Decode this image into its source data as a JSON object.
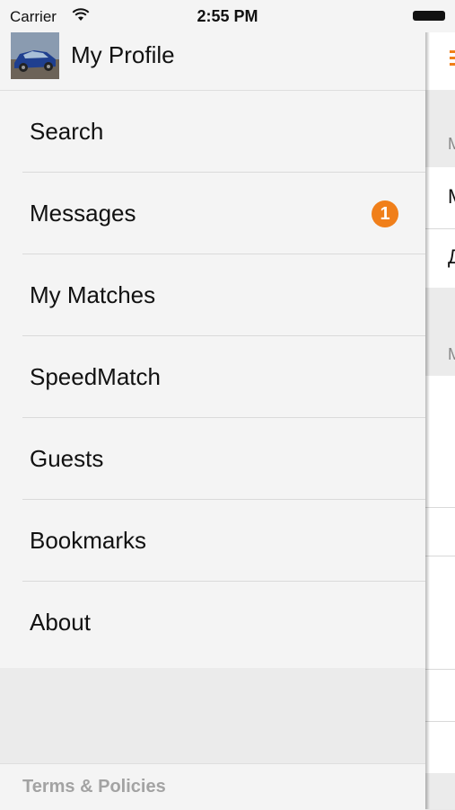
{
  "status_bar": {
    "carrier": "Carrier",
    "time": "2:55 PM"
  },
  "profile": {
    "title": "My Profile",
    "avatar_icon": "car-photo-avatar"
  },
  "menu": {
    "items": [
      {
        "label": "Search"
      },
      {
        "label": "Messages",
        "badge": "1"
      },
      {
        "label": "My Matches"
      },
      {
        "label": "SpeedMatch"
      },
      {
        "label": "Guests"
      },
      {
        "label": "Bookmarks"
      },
      {
        "label": "About"
      }
    ]
  },
  "footer": {
    "link_label": "Terms & Policies"
  },
  "main_peek": {
    "menu_icon": "hamburger-icon",
    "row1": "М",
    "row2": "М",
    "row3": "Д",
    "row4": "М",
    "accent_color": "#f07f1a"
  },
  "colors": {
    "accent": "#f07f1a",
    "drawer_bg": "#f4f4f4",
    "footer_text": "#a3a3a3"
  }
}
